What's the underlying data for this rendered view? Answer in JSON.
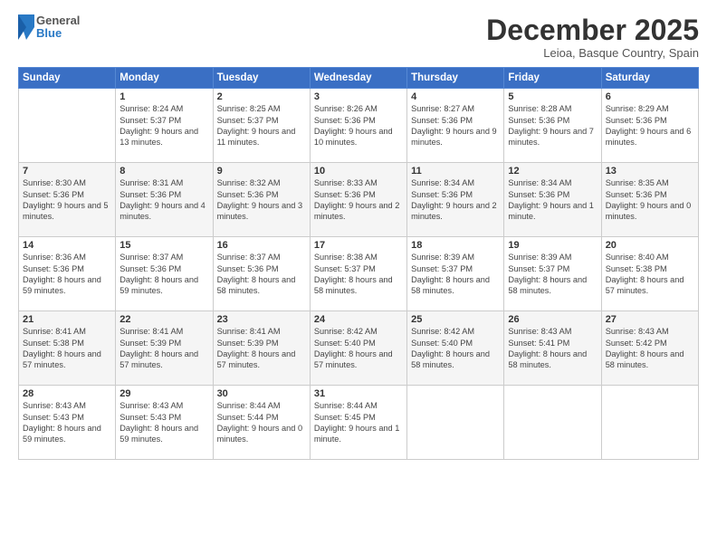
{
  "header": {
    "logo": {
      "general": "General",
      "blue": "Blue"
    },
    "title": "December 2025",
    "location": "Leioa, Basque Country, Spain"
  },
  "days_of_week": [
    "Sunday",
    "Monday",
    "Tuesday",
    "Wednesday",
    "Thursday",
    "Friday",
    "Saturday"
  ],
  "weeks": [
    [
      {
        "day": "",
        "sunrise": "",
        "sunset": "",
        "daylight": ""
      },
      {
        "day": "1",
        "sunrise": "Sunrise: 8:24 AM",
        "sunset": "Sunset: 5:37 PM",
        "daylight": "Daylight: 9 hours and 13 minutes."
      },
      {
        "day": "2",
        "sunrise": "Sunrise: 8:25 AM",
        "sunset": "Sunset: 5:37 PM",
        "daylight": "Daylight: 9 hours and 11 minutes."
      },
      {
        "day": "3",
        "sunrise": "Sunrise: 8:26 AM",
        "sunset": "Sunset: 5:36 PM",
        "daylight": "Daylight: 9 hours and 10 minutes."
      },
      {
        "day": "4",
        "sunrise": "Sunrise: 8:27 AM",
        "sunset": "Sunset: 5:36 PM",
        "daylight": "Daylight: 9 hours and 9 minutes."
      },
      {
        "day": "5",
        "sunrise": "Sunrise: 8:28 AM",
        "sunset": "Sunset: 5:36 PM",
        "daylight": "Daylight: 9 hours and 7 minutes."
      },
      {
        "day": "6",
        "sunrise": "Sunrise: 8:29 AM",
        "sunset": "Sunset: 5:36 PM",
        "daylight": "Daylight: 9 hours and 6 minutes."
      }
    ],
    [
      {
        "day": "7",
        "sunrise": "Sunrise: 8:30 AM",
        "sunset": "Sunset: 5:36 PM",
        "daylight": "Daylight: 9 hours and 5 minutes."
      },
      {
        "day": "8",
        "sunrise": "Sunrise: 8:31 AM",
        "sunset": "Sunset: 5:36 PM",
        "daylight": "Daylight: 9 hours and 4 minutes."
      },
      {
        "day": "9",
        "sunrise": "Sunrise: 8:32 AM",
        "sunset": "Sunset: 5:36 PM",
        "daylight": "Daylight: 9 hours and 3 minutes."
      },
      {
        "day": "10",
        "sunrise": "Sunrise: 8:33 AM",
        "sunset": "Sunset: 5:36 PM",
        "daylight": "Daylight: 9 hours and 2 minutes."
      },
      {
        "day": "11",
        "sunrise": "Sunrise: 8:34 AM",
        "sunset": "Sunset: 5:36 PM",
        "daylight": "Daylight: 9 hours and 2 minutes."
      },
      {
        "day": "12",
        "sunrise": "Sunrise: 8:34 AM",
        "sunset": "Sunset: 5:36 PM",
        "daylight": "Daylight: 9 hours and 1 minute."
      },
      {
        "day": "13",
        "sunrise": "Sunrise: 8:35 AM",
        "sunset": "Sunset: 5:36 PM",
        "daylight": "Daylight: 9 hours and 0 minutes."
      }
    ],
    [
      {
        "day": "14",
        "sunrise": "Sunrise: 8:36 AM",
        "sunset": "Sunset: 5:36 PM",
        "daylight": "Daylight: 8 hours and 59 minutes."
      },
      {
        "day": "15",
        "sunrise": "Sunrise: 8:37 AM",
        "sunset": "Sunset: 5:36 PM",
        "daylight": "Daylight: 8 hours and 59 minutes."
      },
      {
        "day": "16",
        "sunrise": "Sunrise: 8:37 AM",
        "sunset": "Sunset: 5:36 PM",
        "daylight": "Daylight: 8 hours and 58 minutes."
      },
      {
        "day": "17",
        "sunrise": "Sunrise: 8:38 AM",
        "sunset": "Sunset: 5:37 PM",
        "daylight": "Daylight: 8 hours and 58 minutes."
      },
      {
        "day": "18",
        "sunrise": "Sunrise: 8:39 AM",
        "sunset": "Sunset: 5:37 PM",
        "daylight": "Daylight: 8 hours and 58 minutes."
      },
      {
        "day": "19",
        "sunrise": "Sunrise: 8:39 AM",
        "sunset": "Sunset: 5:37 PM",
        "daylight": "Daylight: 8 hours and 58 minutes."
      },
      {
        "day": "20",
        "sunrise": "Sunrise: 8:40 AM",
        "sunset": "Sunset: 5:38 PM",
        "daylight": "Daylight: 8 hours and 57 minutes."
      }
    ],
    [
      {
        "day": "21",
        "sunrise": "Sunrise: 8:41 AM",
        "sunset": "Sunset: 5:38 PM",
        "daylight": "Daylight: 8 hours and 57 minutes."
      },
      {
        "day": "22",
        "sunrise": "Sunrise: 8:41 AM",
        "sunset": "Sunset: 5:39 PM",
        "daylight": "Daylight: 8 hours and 57 minutes."
      },
      {
        "day": "23",
        "sunrise": "Sunrise: 8:41 AM",
        "sunset": "Sunset: 5:39 PM",
        "daylight": "Daylight: 8 hours and 57 minutes."
      },
      {
        "day": "24",
        "sunrise": "Sunrise: 8:42 AM",
        "sunset": "Sunset: 5:40 PM",
        "daylight": "Daylight: 8 hours and 57 minutes."
      },
      {
        "day": "25",
        "sunrise": "Sunrise: 8:42 AM",
        "sunset": "Sunset: 5:40 PM",
        "daylight": "Daylight: 8 hours and 58 minutes."
      },
      {
        "day": "26",
        "sunrise": "Sunrise: 8:43 AM",
        "sunset": "Sunset: 5:41 PM",
        "daylight": "Daylight: 8 hours and 58 minutes."
      },
      {
        "day": "27",
        "sunrise": "Sunrise: 8:43 AM",
        "sunset": "Sunset: 5:42 PM",
        "daylight": "Daylight: 8 hours and 58 minutes."
      }
    ],
    [
      {
        "day": "28",
        "sunrise": "Sunrise: 8:43 AM",
        "sunset": "Sunset: 5:43 PM",
        "daylight": "Daylight: 8 hours and 59 minutes."
      },
      {
        "day": "29",
        "sunrise": "Sunrise: 8:43 AM",
        "sunset": "Sunset: 5:43 PM",
        "daylight": "Daylight: 8 hours and 59 minutes."
      },
      {
        "day": "30",
        "sunrise": "Sunrise: 8:44 AM",
        "sunset": "Sunset: 5:44 PM",
        "daylight": "Daylight: 9 hours and 0 minutes."
      },
      {
        "day": "31",
        "sunrise": "Sunrise: 8:44 AM",
        "sunset": "Sunset: 5:45 PM",
        "daylight": "Daylight: 9 hours and 1 minute."
      },
      {
        "day": "",
        "sunrise": "",
        "sunset": "",
        "daylight": ""
      },
      {
        "day": "",
        "sunrise": "",
        "sunset": "",
        "daylight": ""
      },
      {
        "day": "",
        "sunrise": "",
        "sunset": "",
        "daylight": ""
      }
    ]
  ]
}
